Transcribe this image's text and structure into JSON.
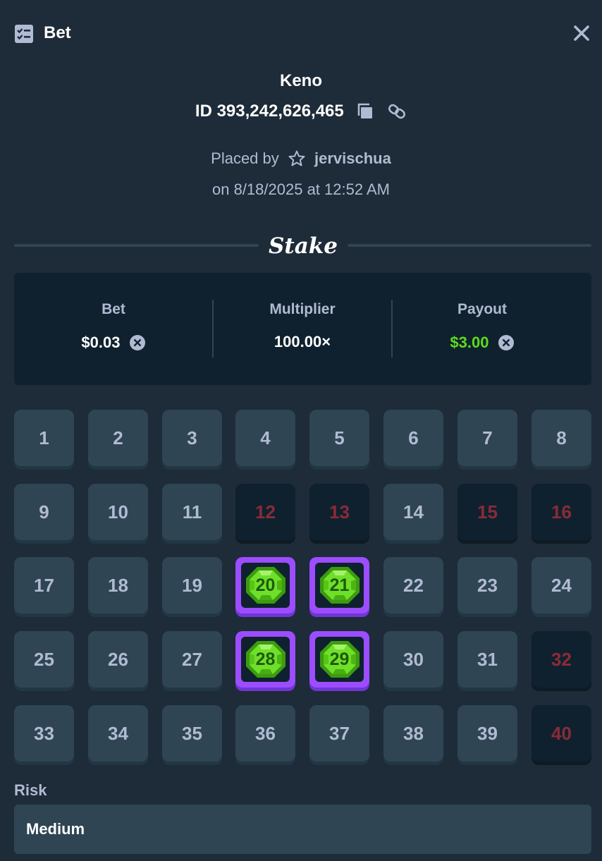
{
  "header": {
    "title": "Bet",
    "icon": "bet-slip-icon",
    "close_icon": "close-icon"
  },
  "game": {
    "name": "Keno",
    "bet_id": "ID 393,242,626,465"
  },
  "placed": {
    "prefix": "Placed by",
    "username": "jervischua",
    "date": "on 8/18/2025 at 12:52 AM"
  },
  "brand": {
    "logo_text": "Stake"
  },
  "summary": {
    "bet_label": "Bet",
    "bet_value": "$0.03",
    "multiplier_label": "Multiplier",
    "multiplier_value": "100.00×",
    "payout_label": "Payout",
    "payout_value": "$3.00"
  },
  "grid": {
    "tiles": [
      {
        "n": "1",
        "state": "normal"
      },
      {
        "n": "2",
        "state": "normal"
      },
      {
        "n": "3",
        "state": "normal"
      },
      {
        "n": "4",
        "state": "normal"
      },
      {
        "n": "5",
        "state": "normal"
      },
      {
        "n": "6",
        "state": "normal"
      },
      {
        "n": "7",
        "state": "normal"
      },
      {
        "n": "8",
        "state": "normal"
      },
      {
        "n": "9",
        "state": "normal"
      },
      {
        "n": "10",
        "state": "normal"
      },
      {
        "n": "11",
        "state": "normal"
      },
      {
        "n": "12",
        "state": "miss"
      },
      {
        "n": "13",
        "state": "miss"
      },
      {
        "n": "14",
        "state": "normal"
      },
      {
        "n": "15",
        "state": "miss"
      },
      {
        "n": "16",
        "state": "miss"
      },
      {
        "n": "17",
        "state": "normal"
      },
      {
        "n": "18",
        "state": "normal"
      },
      {
        "n": "19",
        "state": "normal"
      },
      {
        "n": "20",
        "state": "hit"
      },
      {
        "n": "21",
        "state": "hit"
      },
      {
        "n": "22",
        "state": "normal"
      },
      {
        "n": "23",
        "state": "normal"
      },
      {
        "n": "24",
        "state": "normal"
      },
      {
        "n": "25",
        "state": "normal"
      },
      {
        "n": "26",
        "state": "normal"
      },
      {
        "n": "27",
        "state": "normal"
      },
      {
        "n": "28",
        "state": "hit"
      },
      {
        "n": "29",
        "state": "hit"
      },
      {
        "n": "30",
        "state": "normal"
      },
      {
        "n": "31",
        "state": "normal"
      },
      {
        "n": "32",
        "state": "miss"
      },
      {
        "n": "33",
        "state": "normal"
      },
      {
        "n": "34",
        "state": "normal"
      },
      {
        "n": "35",
        "state": "normal"
      },
      {
        "n": "36",
        "state": "normal"
      },
      {
        "n": "37",
        "state": "normal"
      },
      {
        "n": "38",
        "state": "normal"
      },
      {
        "n": "39",
        "state": "normal"
      },
      {
        "n": "40",
        "state": "miss"
      }
    ]
  },
  "risk": {
    "label": "Risk",
    "value": "Medium"
  },
  "colors": {
    "hit_border": "#9b4dff",
    "gem": "#5ddb1c",
    "miss_text": "#8a2b38",
    "payout": "#5ddb1c"
  }
}
